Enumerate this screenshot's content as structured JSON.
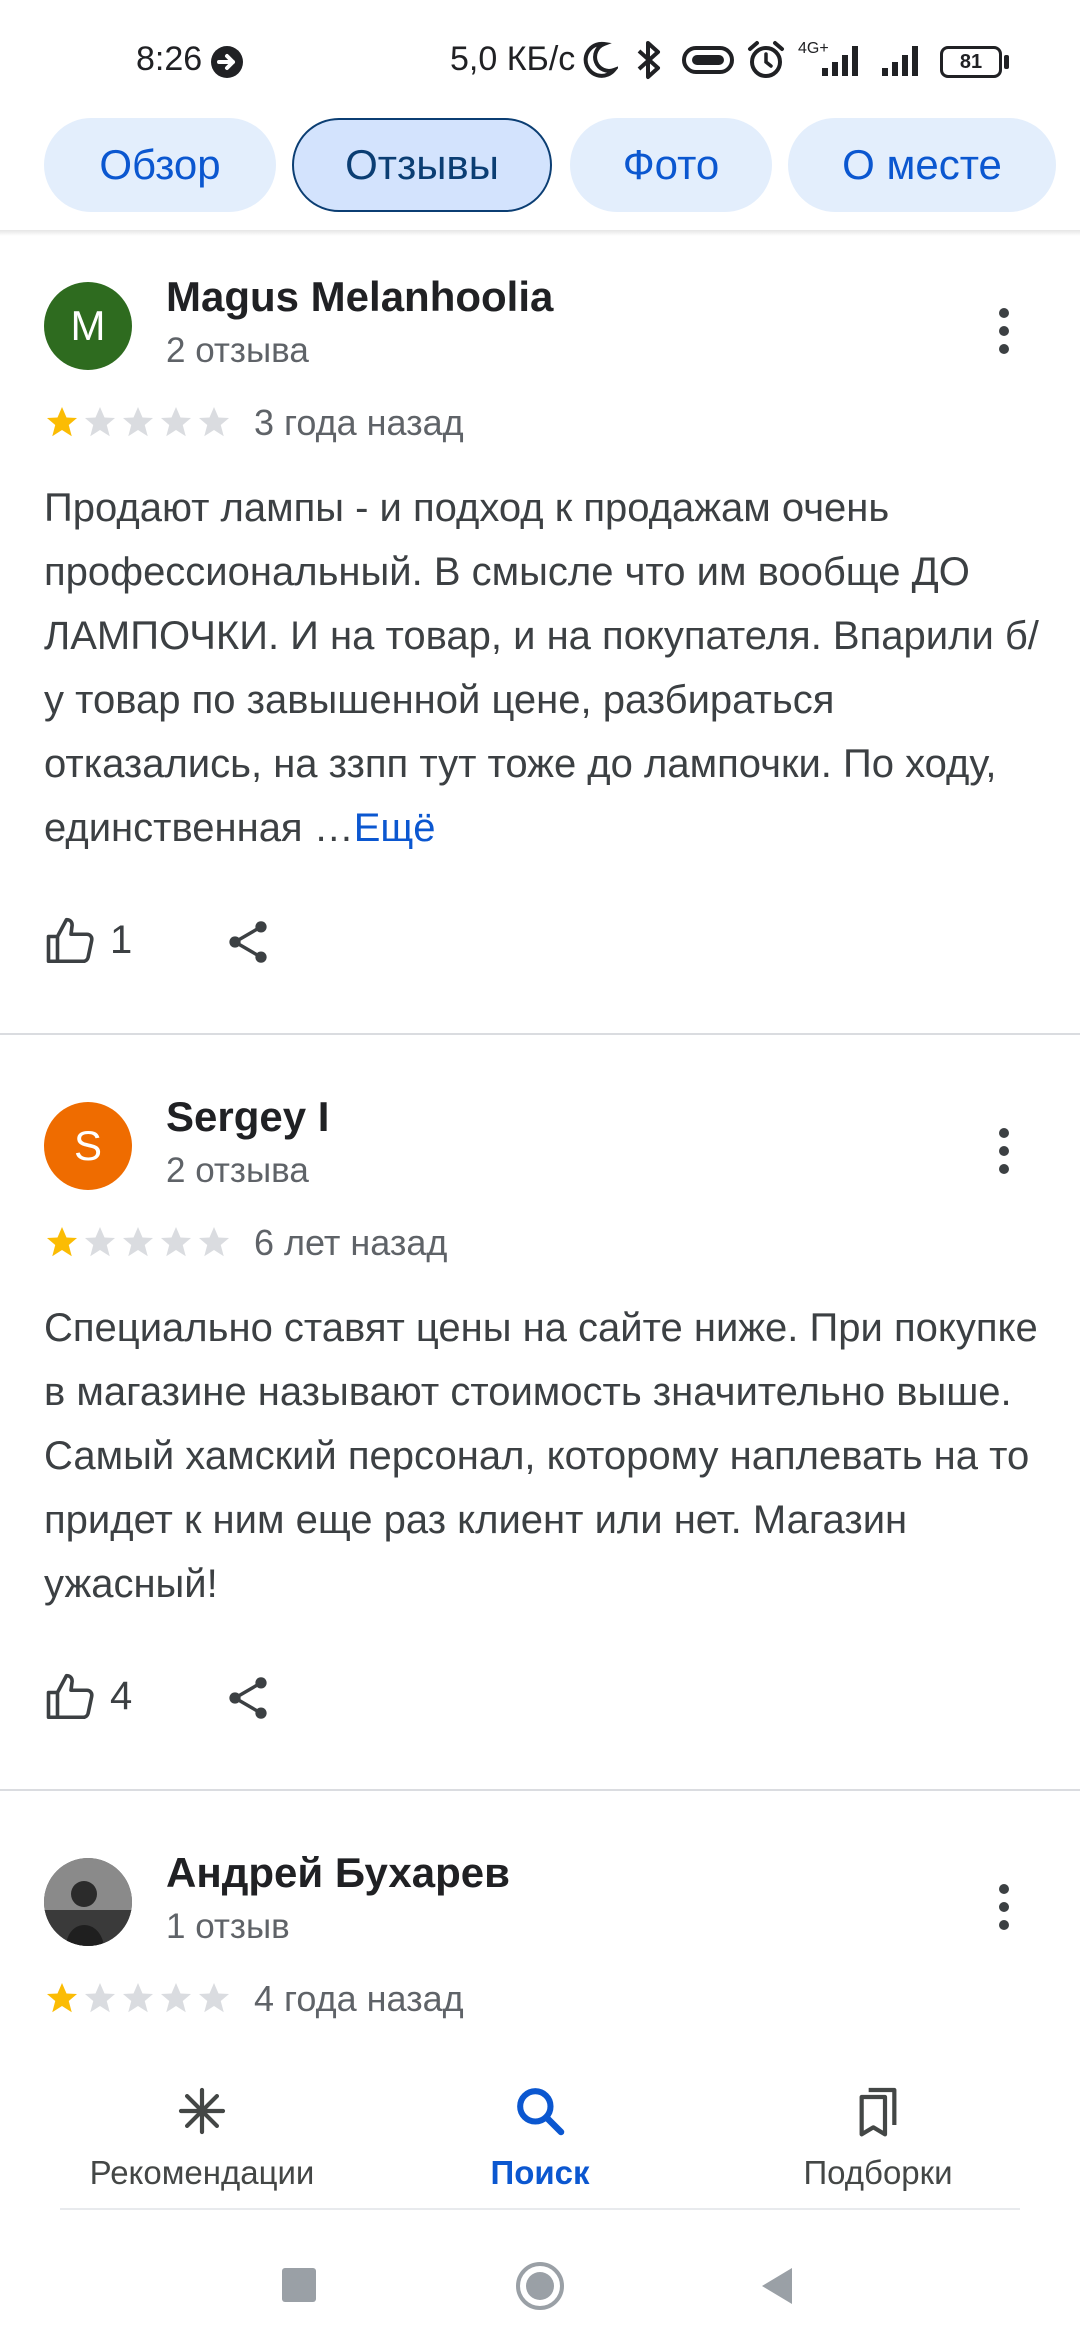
{
  "status_bar": {
    "time": "8:26",
    "network_speed": "5,0 КБ/с",
    "network_type": "4G+",
    "battery": "81"
  },
  "tabs": [
    {
      "label": "Обзор",
      "active": false
    },
    {
      "label": "Отзывы",
      "active": true
    },
    {
      "label": "Фото",
      "active": false
    },
    {
      "label": "О месте",
      "active": false
    }
  ],
  "reviews": [
    {
      "author": "Magus Melanhoolia",
      "avatar_letter": "M",
      "avatar_color": "#2e6b1f",
      "reviews_count": "2 отзыва",
      "rating": 1,
      "date": "3 года назад",
      "text": "Продают лампы - и подход к продажам очень профессиональный. В смысле что им вообще ДО ЛАМПОЧКИ. И на товар, и на покупателя. Впарили б/у товар по завышенной цене, разбираться отказались, на ззпп тут тоже до лампочки. По ходу, единственная …",
      "more_label": "Ещё",
      "likes": "1"
    },
    {
      "author": "Sergey I",
      "avatar_letter": "S",
      "avatar_color": "#ef6c00",
      "reviews_count": "2 отзыва",
      "rating": 1,
      "date": "6 лет назад",
      "text": "Специально ставят цены на сайте ниже. При покупке в магазине называют стоимость значительно выше. Самый хамский персонал, которому наплевать на то придет к ним еще раз клиент или нет. Магазин ужасный!",
      "likes": "4"
    },
    {
      "author": "Андрей Бухарев",
      "avatar_letter": "",
      "avatar_color": "#5a5a5a",
      "reviews_count": "1 отзыв",
      "rating": 1,
      "date": "4 года назад"
    }
  ],
  "bottom_nav": [
    {
      "label": "Рекомендации",
      "icon": "sparkle-icon",
      "active": false
    },
    {
      "label": "Поиск",
      "icon": "search-icon",
      "active": true
    },
    {
      "label": "Подборки",
      "icon": "bookmarks-icon",
      "active": false
    }
  ],
  "colors": {
    "accent": "#0b57d0",
    "star_filled": "#fbbc04",
    "star_empty": "#dadce0"
  }
}
